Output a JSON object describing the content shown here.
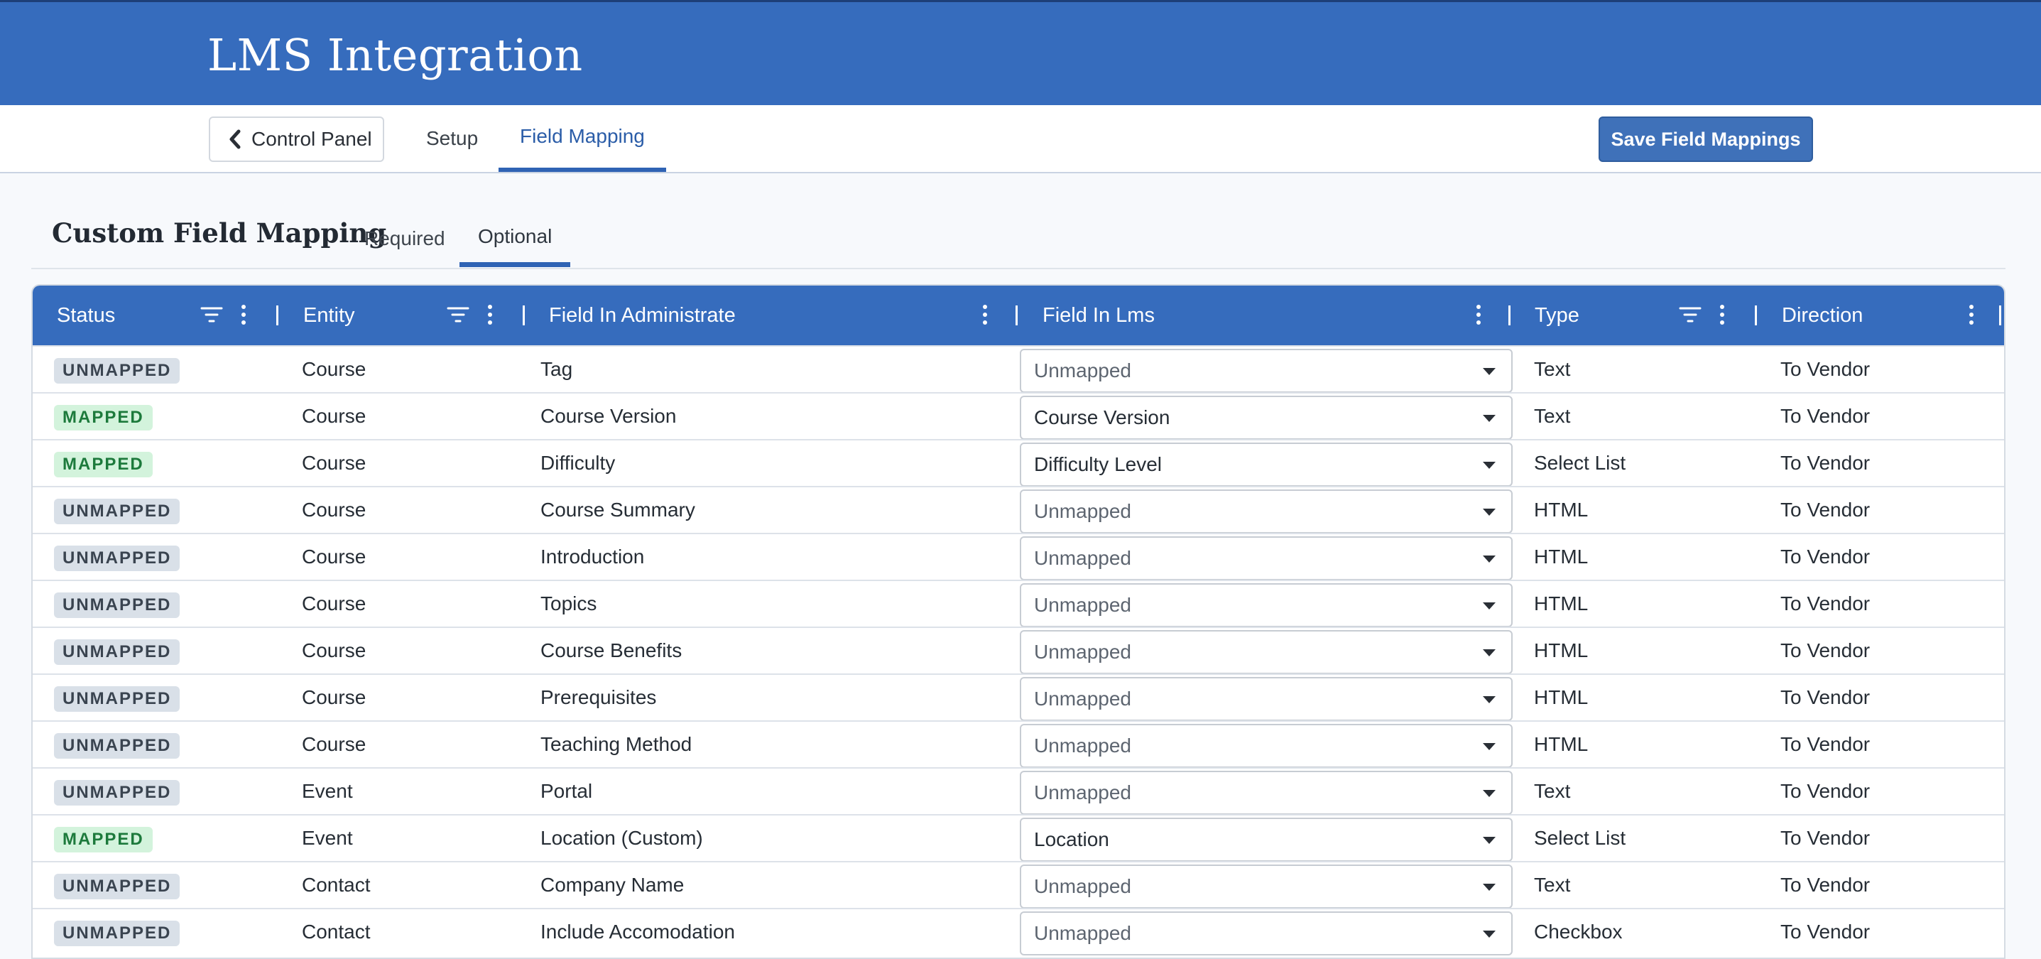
{
  "app": {
    "title": "LMS Integration"
  },
  "nav": {
    "back_label": "Control Panel",
    "tabs": [
      {
        "label": "Setup",
        "active": false
      },
      {
        "label": "Field Mapping",
        "active": true
      }
    ],
    "save_label": "Save Field Mappings"
  },
  "section": {
    "title": "Custom Field Mapping",
    "tabs": [
      {
        "label": "Required",
        "active": false
      },
      {
        "label": "Optional",
        "active": true
      }
    ]
  },
  "grid": {
    "columns": [
      "Status",
      "Entity",
      "Field In Administrate",
      "Field In Lms",
      "Type",
      "Direction"
    ],
    "rows": [
      {
        "status": "UNMAPPED",
        "entity": "Course",
        "field_admin": "Tag",
        "field_lms": "Unmapped",
        "mapped": false,
        "type": "Text",
        "direction": "To Vendor"
      },
      {
        "status": "MAPPED",
        "entity": "Course",
        "field_admin": "Course Version",
        "field_lms": "Course Version",
        "mapped": true,
        "type": "Text",
        "direction": "To Vendor"
      },
      {
        "status": "MAPPED",
        "entity": "Course",
        "field_admin": "Difficulty",
        "field_lms": "Difficulty Level",
        "mapped": true,
        "type": "Select List",
        "direction": "To Vendor"
      },
      {
        "status": "UNMAPPED",
        "entity": "Course",
        "field_admin": "Course Summary",
        "field_lms": "Unmapped",
        "mapped": false,
        "type": "HTML",
        "direction": "To Vendor"
      },
      {
        "status": "UNMAPPED",
        "entity": "Course",
        "field_admin": "Introduction",
        "field_lms": "Unmapped",
        "mapped": false,
        "type": "HTML",
        "direction": "To Vendor"
      },
      {
        "status": "UNMAPPED",
        "entity": "Course",
        "field_admin": "Topics",
        "field_lms": "Unmapped",
        "mapped": false,
        "type": "HTML",
        "direction": "To Vendor"
      },
      {
        "status": "UNMAPPED",
        "entity": "Course",
        "field_admin": "Course Benefits",
        "field_lms": "Unmapped",
        "mapped": false,
        "type": "HTML",
        "direction": "To Vendor"
      },
      {
        "status": "UNMAPPED",
        "entity": "Course",
        "field_admin": "Prerequisites",
        "field_lms": "Unmapped",
        "mapped": false,
        "type": "HTML",
        "direction": "To Vendor"
      },
      {
        "status": "UNMAPPED",
        "entity": "Course",
        "field_admin": "Teaching Method",
        "field_lms": "Unmapped",
        "mapped": false,
        "type": "HTML",
        "direction": "To Vendor"
      },
      {
        "status": "UNMAPPED",
        "entity": "Event",
        "field_admin": "Portal",
        "field_lms": "Unmapped",
        "mapped": false,
        "type": "Text",
        "direction": "To Vendor"
      },
      {
        "status": "MAPPED",
        "entity": "Event",
        "field_admin": "Location (Custom)",
        "field_lms": "Location",
        "mapped": true,
        "type": "Select List",
        "direction": "To Vendor"
      },
      {
        "status": "UNMAPPED",
        "entity": "Contact",
        "field_admin": "Company Name",
        "field_lms": "Unmapped",
        "mapped": false,
        "type": "Text",
        "direction": "To Vendor"
      },
      {
        "status": "UNMAPPED",
        "entity": "Contact",
        "field_admin": "Include Accomodation",
        "field_lms": "Unmapped",
        "mapped": false,
        "type": "Checkbox",
        "direction": "To Vendor"
      }
    ]
  },
  "colors": {
    "brand_blue": "#366cbd",
    "mapped_bg": "#d3f3dc",
    "mapped_fg": "#1d7a3c",
    "unmapped_bg": "#d9e0e8",
    "unmapped_fg": "#3a4450"
  }
}
